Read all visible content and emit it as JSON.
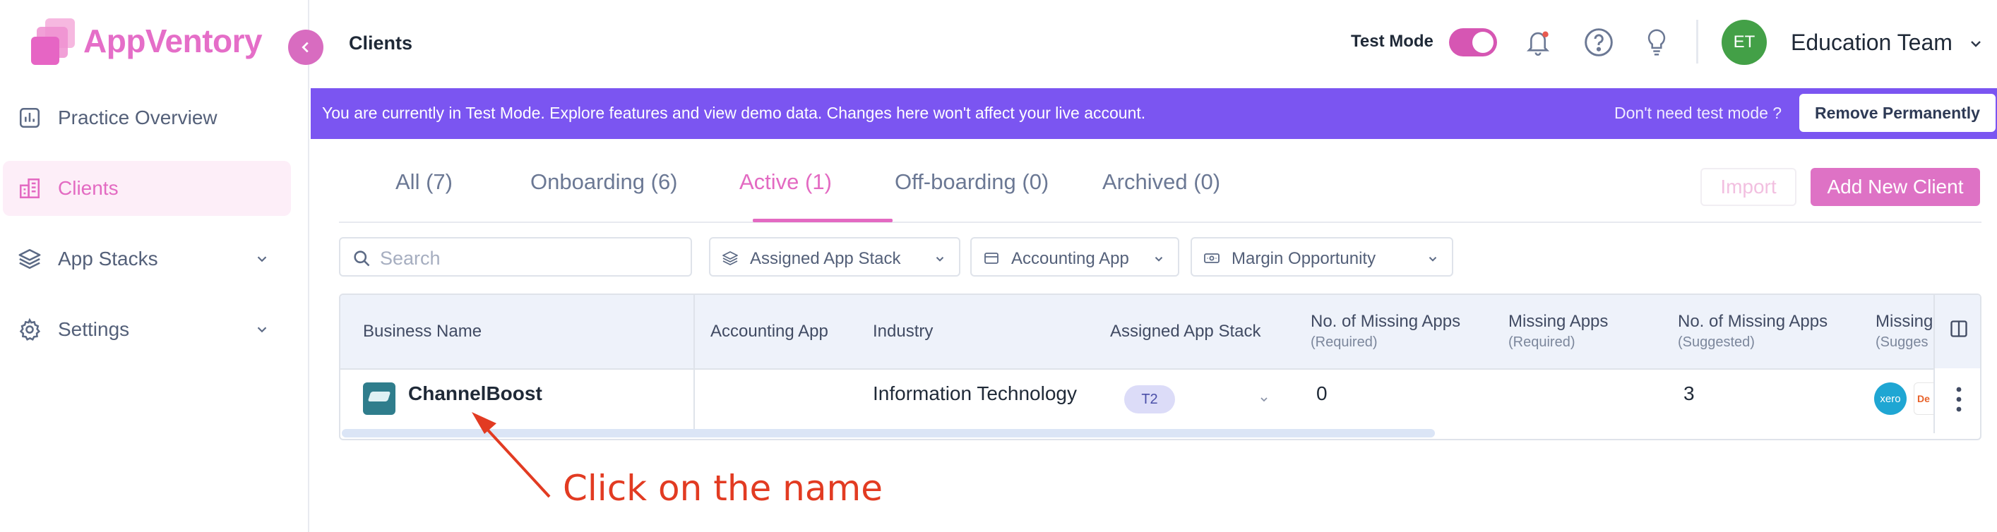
{
  "app": {
    "name": "AppVentory"
  },
  "sidebar": {
    "items": [
      {
        "label": "Practice Overview",
        "icon": "bar-chart-icon"
      },
      {
        "label": "Clients",
        "icon": "building-icon",
        "active": true
      },
      {
        "label": "App Stacks",
        "icon": "layers-icon",
        "expandable": true
      },
      {
        "label": "Settings",
        "icon": "gear-icon",
        "expandable": true
      }
    ]
  },
  "header": {
    "title": "Clients",
    "test_mode_label": "Test Mode",
    "test_mode_on": true,
    "avatar_initials": "ET",
    "team_name": "Education Team"
  },
  "banner": {
    "message": "You are currently in Test Mode. Explore features and view demo data. Changes here won't affect your live account.",
    "question": "Don't need test mode ?",
    "button": "Remove Permanently"
  },
  "tabs": [
    {
      "label": "All (7)"
    },
    {
      "label": "Onboarding (6)"
    },
    {
      "label": "Active (1)",
      "active": true
    },
    {
      "label": "Off-boarding (0)"
    },
    {
      "label": "Archived (0)"
    }
  ],
  "actions": {
    "import": "Import",
    "add": "Add New Client"
  },
  "filters": {
    "search_placeholder": "Search",
    "assigned_app_stack": "Assigned App Stack",
    "accounting_app": "Accounting App",
    "margin_opportunity": "Margin Opportunity"
  },
  "table": {
    "columns": {
      "business_name": "Business Name",
      "accounting_app": "Accounting App",
      "industry": "Industry",
      "assigned_app_stack": "Assigned App Stack",
      "missing_count_required": "No. of Missing Apps",
      "missing_count_required_sub": "(Required)",
      "missing_required": "Missing Apps",
      "missing_required_sub": "(Required)",
      "missing_count_suggested": "No. of Missing Apps",
      "missing_count_suggested_sub": "(Suggested)",
      "missing_suggested": "Missing",
      "missing_suggested_sub": "(Sugges"
    },
    "rows": [
      {
        "business_name": "ChannelBoost",
        "accounting_app": "",
        "industry": "Information Technology",
        "app_stack": "T2",
        "missing_count_required": "0",
        "missing_count_suggested": "3",
        "app_icons": [
          "xero",
          "De"
        ]
      }
    ]
  },
  "annotation": {
    "text": "Click on the name",
    "color": "#e23b22"
  },
  "colors": {
    "brand": "#e36ac2",
    "banner": "#7b55f1",
    "avatar": "#43a047"
  }
}
